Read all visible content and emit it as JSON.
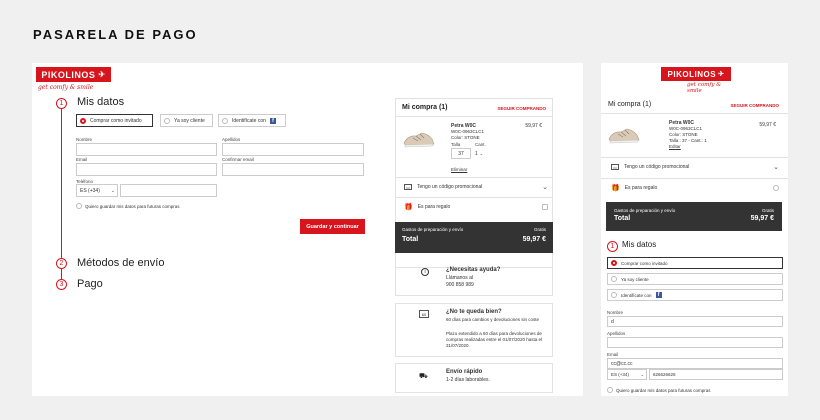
{
  "page_title": "PASARELA DE PAGO",
  "brand": {
    "name": "PIKOLINOS",
    "slogan": "get comfy & smile"
  },
  "steps": [
    {
      "num": "1",
      "label": "Mis datos"
    },
    {
      "num": "2",
      "label": "Métodos de envío"
    },
    {
      "num": "3",
      "label": "Pago"
    }
  ],
  "checkout_options": {
    "guest": "Comprar como invitado",
    "client": "Ya soy cliente",
    "facebook": "Identifícate con",
    "facebook_icon": "f"
  },
  "form": {
    "nombre_label": "Nombre",
    "apellidos_label": "Apellidos",
    "email_label": "Email",
    "confirm_email_label": "Confirmar email",
    "telefono_label": "Teléfono",
    "phone_prefix": "ES (+34)",
    "save_data": "Quiero guardar mis datos para futuras compras",
    "submit": "Guardar y continuar"
  },
  "cart": {
    "title": "Mi compra (1)",
    "continue": "SEGUIR COMPRANDO",
    "product": {
      "name": "Petra W0C",
      "ref": "W0C-0963CLC1",
      "color": "Color: STONE",
      "price": "59,97 €",
      "talla_label": "Talla",
      "cant_label": "Cant.",
      "talla": "37",
      "cant": "1",
      "remove": "Eliminar",
      "mobile_size_qty": "Talla : 37 - Cant.: 1",
      "mobile_edit": "Editar"
    },
    "promo": "Tengo un código promocional",
    "gift": "Es para regalo",
    "shipping_label": "Gastos de preparación y envío",
    "shipping_value": "Gratis",
    "total_label": "Total",
    "total_value": "59,97 €"
  },
  "help": {
    "title": "¿Necesitas ayuda?",
    "call": "Llámanos al",
    "phone": "900 858 989"
  },
  "fit": {
    "icon_text": "60",
    "title": "¿No te queda bien?",
    "line1": "60 días para cambios y devoluciones sin coste",
    "line2": "Plazo extendido a 60 días para devoluciones de compras realizadas entre el 01/07/2020 hasta el 31/07/2020."
  },
  "shipping_fast": {
    "title": "Envío rápido",
    "desc": "1-2 días laborables."
  },
  "mobile": {
    "nombre_value": "d",
    "email_value": "cc@cc.cc",
    "phone_value": "626626626",
    "save_data": "Quiero guardar mis datos para futuras compras"
  },
  "colors": {
    "brand_red": "#d8141c",
    "dark_total": "#333333"
  }
}
